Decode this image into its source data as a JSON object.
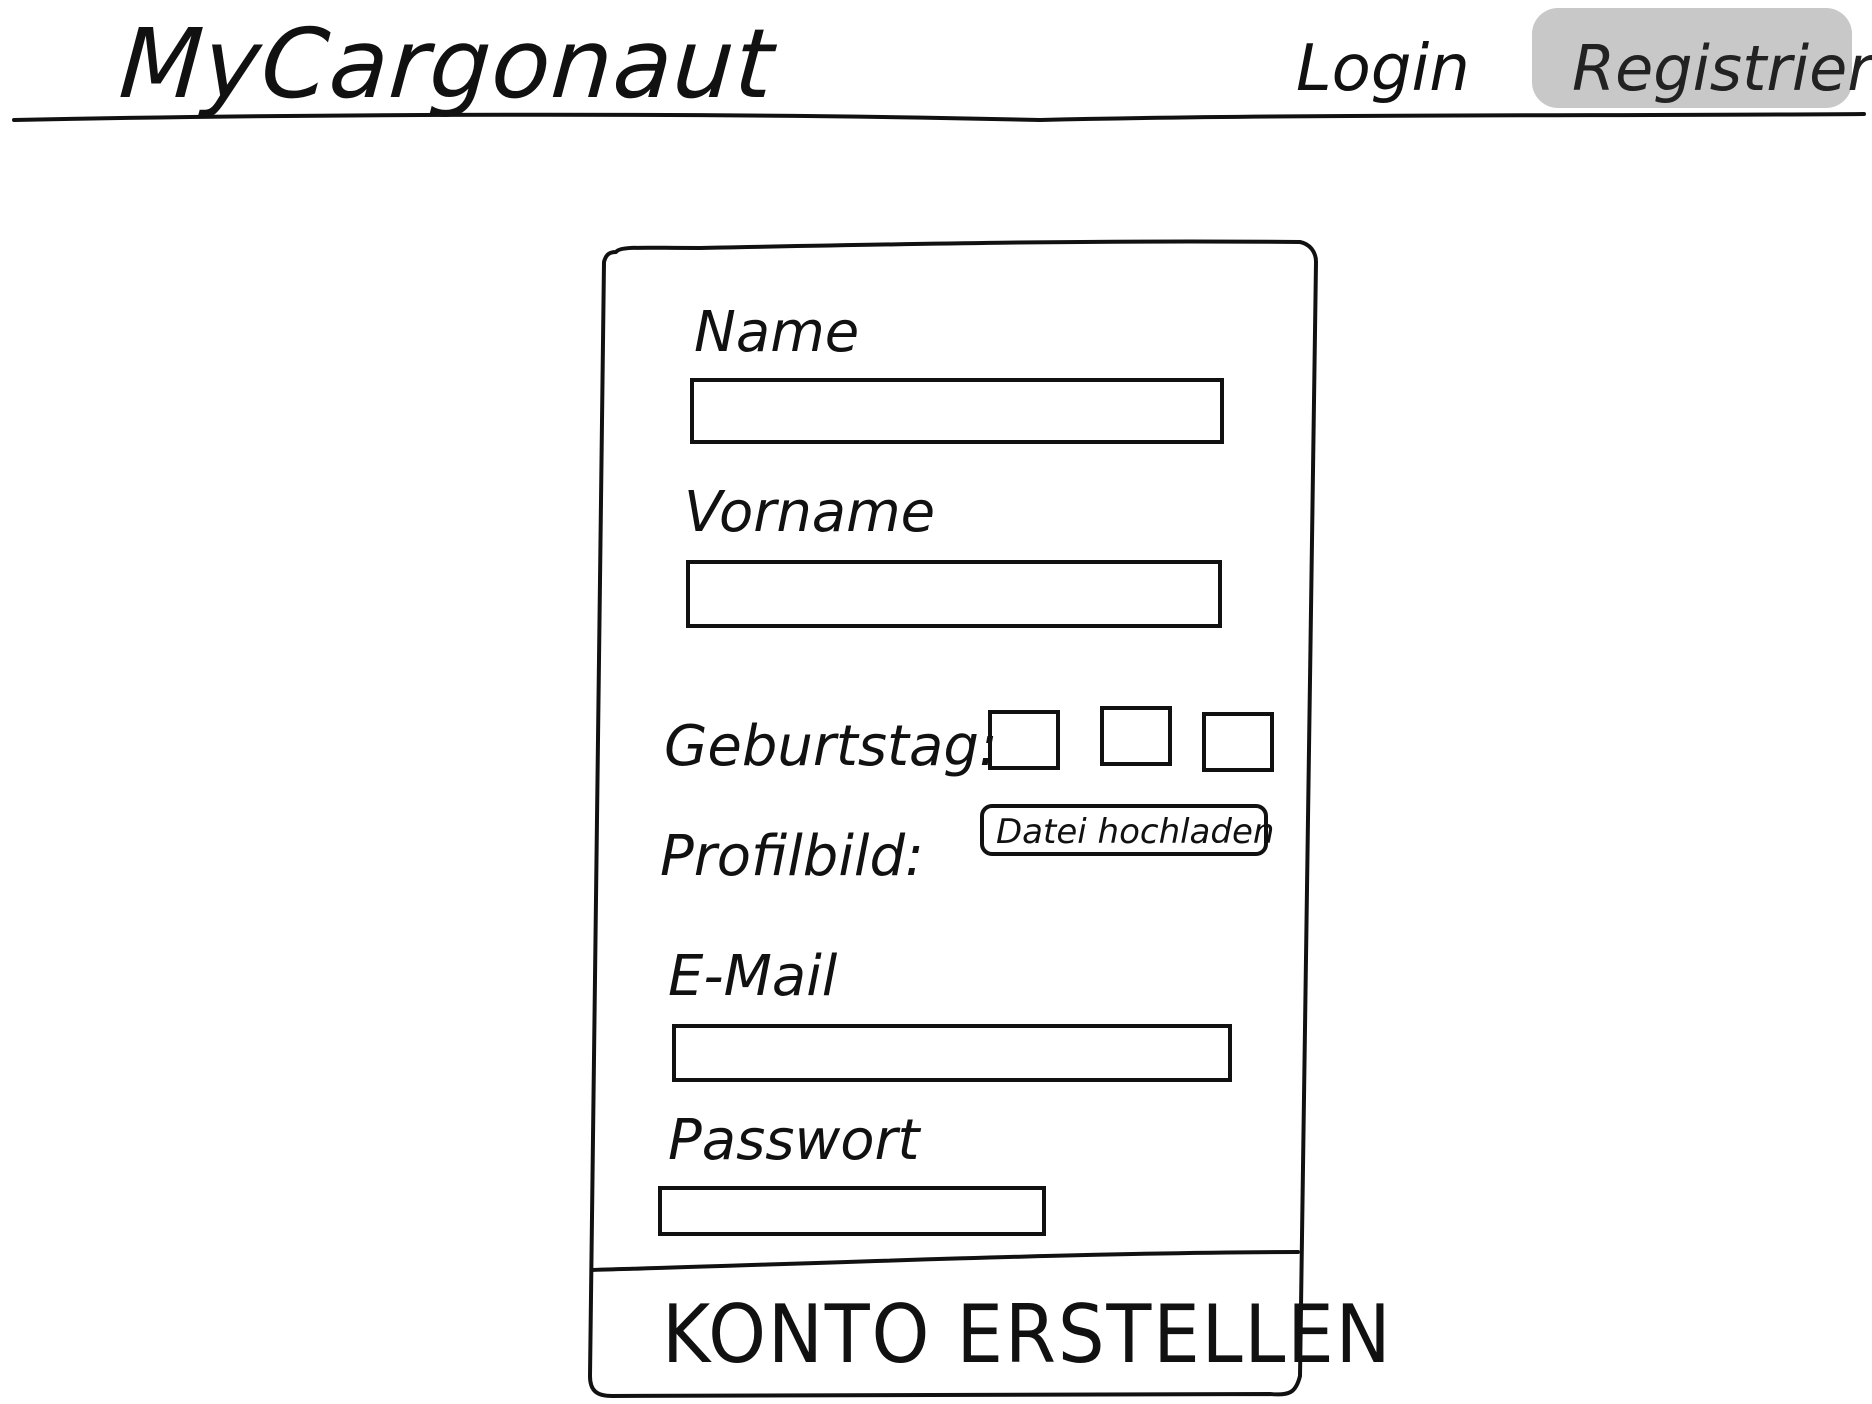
{
  "header": {
    "logo": "MyCargonaut",
    "nav": {
      "login": "Login",
      "register": "Registrieren"
    },
    "active_nav_highlight": "#c8c8c8"
  },
  "form": {
    "name_label": "Name",
    "vorname_label": "Vorname",
    "birthday_label": "Geburtstag:",
    "profile_picture_label": "Profilbild:",
    "upload_button": "Datei hochladen",
    "email_label": "E-Mail",
    "password_label": "Passwort",
    "submit_button": "KONTO ERSTELLEN"
  }
}
